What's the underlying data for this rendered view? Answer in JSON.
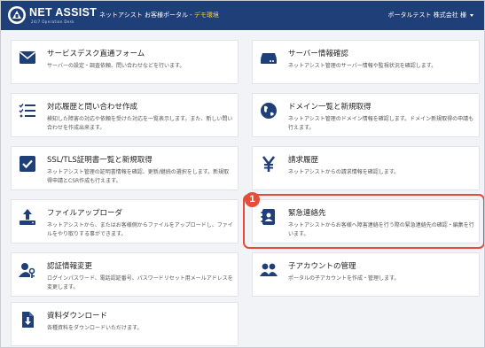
{
  "header": {
    "brand": "NET ASSIST",
    "brand_sub": "24/7 Operation Desk",
    "portal_title": "ネットアシスト お客様ポータル - ",
    "demo_label": "デモ環境",
    "user": "ポータルテスト 株式会社 様"
  },
  "cards": [
    {
      "title": "サービスデスク直通フォーム",
      "desc": "サーバーの設定・調査依頼、問い合わせなどを行います。",
      "icon": "mail-icon"
    },
    {
      "title": "サーバー情報確認",
      "desc": "ネットアシスト管理のサーバー情報や監視状況を確認します。",
      "icon": "server-icon"
    },
    {
      "title": "対応履歴と問い合わせ作成",
      "desc": "検知した障害の対応や依頼を受けた対応を一覧表示します。また、新しい問い合わせを作成出来ます。",
      "icon": "list-icon"
    },
    {
      "title": "ドメイン一覧と新規取得",
      "desc": "ネットアシスト管理のドメイン情報を確認します。ドメイン新規取得の申請も行えます。",
      "icon": "globe-icon"
    },
    {
      "title": "SSL/TLS証明書一覧と新規取得",
      "desc": "ネットアシスト管理の証明書情報を確認、更新/継続の選択をします。新規取得申請とCSR作成も行えます。",
      "icon": "checkbox-icon"
    },
    {
      "title": "請求履歴",
      "desc": "ネットアシストからの請求情報を確認します。",
      "icon": "yen-icon"
    },
    {
      "title": "ファイルアップローダ",
      "desc": "ネットアシストから、またはお客様側からファイルをアップロードし、ファイルをやり取りする事ができます。",
      "icon": "upload-icon"
    },
    {
      "title": "緊急連絡先",
      "desc": "ネットアシストからお客様へ障害連絡を行う際の緊急連絡先の確認・編集を行います。",
      "icon": "contact-book-icon"
    },
    {
      "title": "認証情報変更",
      "desc": "ログインパスワード、電話認証番号、パスワードリセット用メールアドレスを変更します。",
      "icon": "user-key-icon"
    },
    {
      "title": "子アカウントの管理",
      "desc": "ポータルの子アカウントを作成・管理します。",
      "icon": "users-icon"
    },
    {
      "title": "資料ダウンロード",
      "desc": "各種資料をダウンロードいただけます。",
      "icon": "download-file-icon"
    }
  ],
  "callout": {
    "number": "1"
  },
  "colors": {
    "header": "#1f3f78",
    "icon": "#1f3f78",
    "highlight": "#e24e3a",
    "demo": "#f5d14b"
  }
}
